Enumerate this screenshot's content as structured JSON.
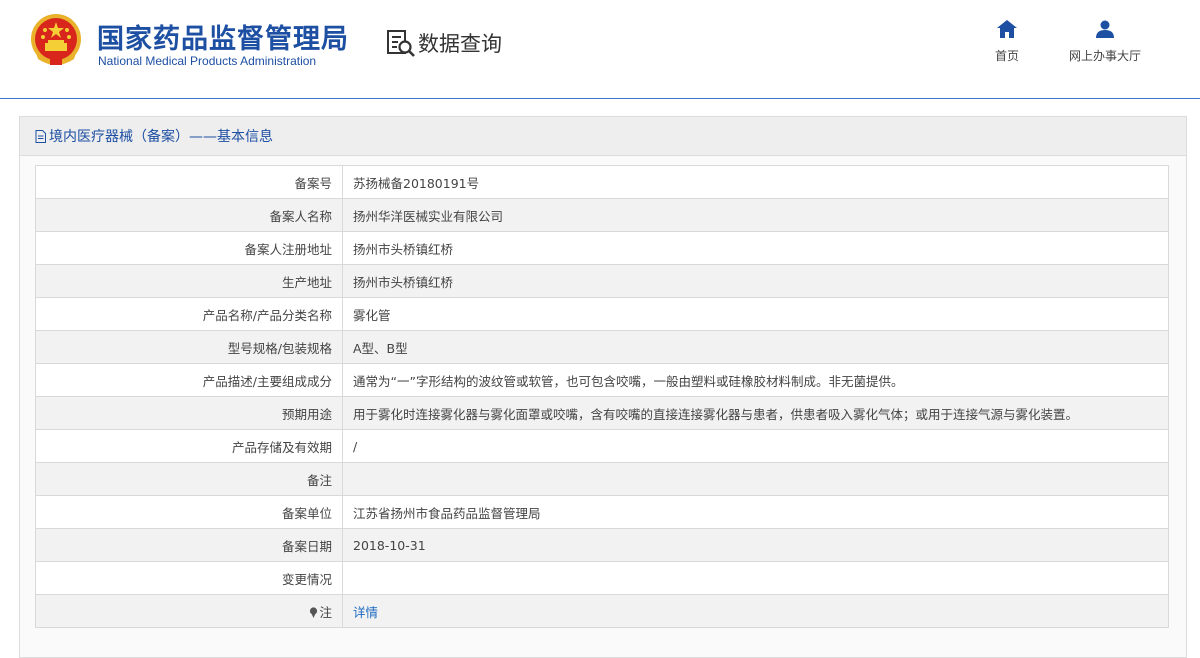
{
  "header": {
    "title_cn": "国家药品监督管理局",
    "title_en": "National Medical Products Administration",
    "query_label": "数据查询",
    "query_icon": "search-document-icon",
    "emblem_icon": "national-emblem-icon",
    "nav": [
      {
        "label": "首页",
        "icon": "home-icon"
      },
      {
        "label": "网上办事大厅",
        "icon": "user-icon"
      }
    ],
    "colors": {
      "brand": "#1d4fa3",
      "accent": "#3d77c9"
    }
  },
  "panel": {
    "title": "境内医疗器械（备案）——基本信息",
    "title_icon": "document-icon"
  },
  "rows": [
    {
      "label": "备案号",
      "value": "苏扬械备20180191号"
    },
    {
      "label": "备案人名称",
      "value": "扬州华洋医械实业有限公司"
    },
    {
      "label": "备案人注册地址",
      "value": "扬州市头桥镇红桥"
    },
    {
      "label": "生产地址",
      "value": "扬州市头桥镇红桥"
    },
    {
      "label": "产品名称/产品分类名称",
      "value": "雾化管"
    },
    {
      "label": "型号规格/包装规格",
      "value": "A型、B型"
    },
    {
      "label": "产品描述/主要组成成分",
      "value": "通常为“一”字形结构的波纹管或软管，也可包含咬嘴，一般由塑料或硅橡胶材料制成。非无菌提供。"
    },
    {
      "label": "预期用途",
      "value": "用于雾化时连接雾化器与雾化面罩或咬嘴，含有咬嘴的直接连接雾化器与患者，供患者吸入雾化气体；或用于连接气源与雾化装置。"
    },
    {
      "label": "产品存储及有效期",
      "value": "/"
    },
    {
      "label": "备注",
      "value": ""
    },
    {
      "label": "备案单位",
      "value": "江苏省扬州市食品药品监督管理局"
    },
    {
      "label": "备案日期",
      "value": "2018-10-31"
    },
    {
      "label": "变更情况",
      "value": ""
    },
    {
      "label": "注",
      "value": "详情",
      "icon": "pin-icon"
    }
  ]
}
